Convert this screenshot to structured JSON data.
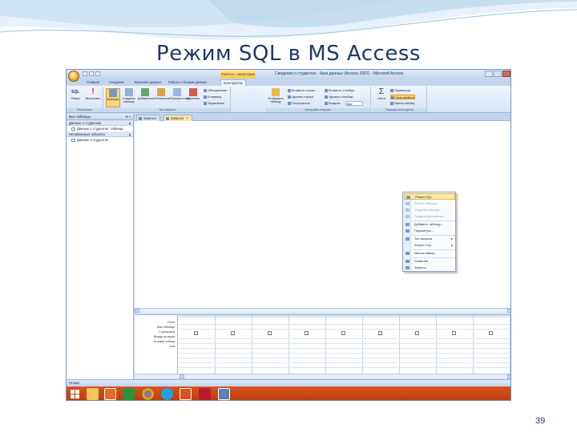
{
  "slide": {
    "title": "Режим SQL в MS Access",
    "page_number": "39"
  },
  "app": {
    "window_title": "Сведения о студентах : база данных (Access 2007) - Microsoft Access",
    "contextual_tab": "Работа с запросами"
  },
  "ribbon_tabs": [
    "Главная",
    "Создание",
    "Внешние данные",
    "Работа с базами данных",
    "Конструктор"
  ],
  "ribbon_groups": {
    "results": {
      "label": "Результаты",
      "buttons": [
        "Режим",
        "Выполнить"
      ]
    },
    "query_type": {
      "label": "Тип запроса",
      "buttons": [
        "Выборка",
        "Создание таблицы",
        "Добавление",
        "Обновление",
        "Перекрестный",
        "Удаление"
      ],
      "small": [
        "Объединение",
        "К серверу",
        "Управление"
      ]
    },
    "query_setup": {
      "label": "Настройка запроса",
      "big": "Отобразить таблицу",
      "small": [
        "Вставить строки",
        "Удалить строки",
        "Построитель",
        "Вставить столбцы",
        "Удалить столбцы",
        "Возврат:"
      ],
      "return_value": "Все"
    },
    "show_hide": {
      "label": "Показать или скрыть",
      "big": "Итоги",
      "small": [
        "Параметры",
        "Окно свойств",
        "Имена таблиц"
      ]
    }
  },
  "nav_pane": {
    "header": "Все таблицы",
    "section": "Данные о студентах",
    "section_item": "Данные о студентах: таблица",
    "section2": "Несвязанные объекты",
    "section2_item": "Данные о студентах"
  },
  "doc_tabs": [
    "Запрос1",
    "Запрос2"
  ],
  "grid_rows": [
    "Поле:",
    "Имя таблицы:",
    "Сортировка:",
    "Вывод на экран:",
    "Условие отбора:",
    "или:"
  ],
  "context_menu": [
    {
      "label": "Режим SQL",
      "state": "highlight"
    },
    {
      "label": "Режим таблицы",
      "state": "disabled"
    },
    {
      "label": "Сводная таблица",
      "state": "disabled"
    },
    {
      "label": "Сводная диаграмма",
      "state": "disabled"
    },
    {
      "label": "Добавить таблицу...",
      "state": "normal"
    },
    {
      "label": "Параметры...",
      "state": "normal"
    },
    {
      "label": "Тип запроса",
      "state": "submenu"
    },
    {
      "label": "Запрос SQL",
      "state": "submenu"
    },
    {
      "label": "Имена таблиц",
      "state": "normal"
    },
    {
      "label": "Свойства",
      "state": "normal"
    },
    {
      "label": "Закрыть",
      "state": "normal"
    }
  ],
  "status_bar": "Готово",
  "colors": {
    "title": "#1f3864",
    "ribbon": "#d7e4f4",
    "highlight": "#fde9a3",
    "taskbar": "#c4410f"
  },
  "taskbar_icons": [
    "start-icon",
    "explorer-icon",
    "media-icon",
    "app-icon",
    "chrome-icon",
    "skype-icon",
    "tool-icon",
    "access-icon",
    "window-icon"
  ]
}
